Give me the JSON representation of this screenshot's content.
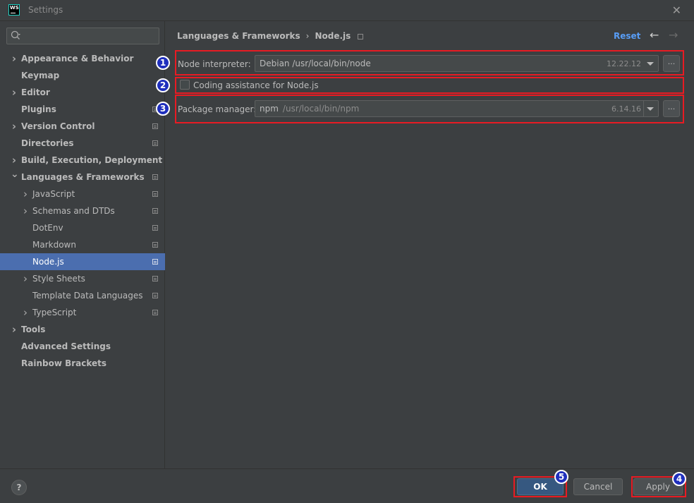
{
  "window": {
    "title": "Settings",
    "logo_text": "WS"
  },
  "sidebar": {
    "search": {
      "value": "",
      "placeholder": ""
    },
    "items": [
      {
        "label": "Appearance & Behavior",
        "bold": true,
        "expandable": true,
        "expanded": false,
        "indent": 0,
        "project_icon": false
      },
      {
        "label": "Keymap",
        "bold": true,
        "expandable": false,
        "indent": 0,
        "project_icon": false
      },
      {
        "label": "Editor",
        "bold": true,
        "expandable": true,
        "expanded": false,
        "indent": 0,
        "project_icon": false
      },
      {
        "label": "Plugins",
        "bold": true,
        "expandable": false,
        "indent": 0,
        "project_icon": true
      },
      {
        "label": "Version Control",
        "bold": true,
        "expandable": true,
        "expanded": false,
        "indent": 0,
        "project_icon": true
      },
      {
        "label": "Directories",
        "bold": true,
        "expandable": false,
        "indent": 0,
        "project_icon": true
      },
      {
        "label": "Build, Execution, Deployment",
        "bold": true,
        "expandable": true,
        "expanded": false,
        "indent": 0,
        "project_icon": false
      },
      {
        "label": "Languages & Frameworks",
        "bold": true,
        "expandable": true,
        "expanded": true,
        "indent": 0,
        "project_icon": true
      },
      {
        "label": "JavaScript",
        "bold": false,
        "expandable": true,
        "expanded": false,
        "indent": 1,
        "project_icon": true
      },
      {
        "label": "Schemas and DTDs",
        "bold": false,
        "expandable": true,
        "expanded": false,
        "indent": 1,
        "project_icon": true
      },
      {
        "label": "DotEnv",
        "bold": false,
        "expandable": false,
        "indent": 1,
        "project_icon": true
      },
      {
        "label": "Markdown",
        "bold": false,
        "expandable": false,
        "indent": 1,
        "project_icon": true
      },
      {
        "label": "Node.js",
        "bold": false,
        "expandable": false,
        "indent": 1,
        "project_icon": true,
        "selected": true
      },
      {
        "label": "Style Sheets",
        "bold": false,
        "expandable": true,
        "expanded": false,
        "indent": 1,
        "project_icon": true
      },
      {
        "label": "Template Data Languages",
        "bold": false,
        "expandable": false,
        "indent": 1,
        "project_icon": true
      },
      {
        "label": "TypeScript",
        "bold": false,
        "expandable": true,
        "expanded": false,
        "indent": 1,
        "project_icon": true
      },
      {
        "label": "Tools",
        "bold": true,
        "expandable": true,
        "expanded": false,
        "indent": 0,
        "project_icon": false
      },
      {
        "label": "Advanced Settings",
        "bold": true,
        "expandable": false,
        "indent": 0,
        "project_icon": false
      },
      {
        "label": "Rainbow Brackets",
        "bold": true,
        "expandable": false,
        "indent": 0,
        "project_icon": false
      }
    ]
  },
  "header": {
    "breadcrumb_parent": "Languages & Frameworks",
    "breadcrumb_current": "Node.js",
    "reset_label": "Reset"
  },
  "form": {
    "node_interpreter": {
      "label": "Node interpreter:",
      "value": "Debian /usr/local/bin/node",
      "version": "12.22.12",
      "browse_label": "..."
    },
    "coding_assistance": {
      "label": "Coding assistance for Node.js",
      "checked": false
    },
    "package_manager": {
      "label": "Package manager:",
      "name": "npm",
      "path": "/usr/local/bin/npm",
      "version": "6.14.16",
      "browse_label": "..."
    }
  },
  "badges": [
    "1",
    "2",
    "3",
    "4",
    "5"
  ],
  "footer": {
    "help_label": "?",
    "ok_label": "OK",
    "cancel_label": "Cancel",
    "apply_label": "Apply"
  },
  "colors": {
    "background": "#3c3f41",
    "selection": "#4b6eaf",
    "link": "#589df6",
    "highlight_border": "#e81b23",
    "badge": "#1f2fbd"
  }
}
